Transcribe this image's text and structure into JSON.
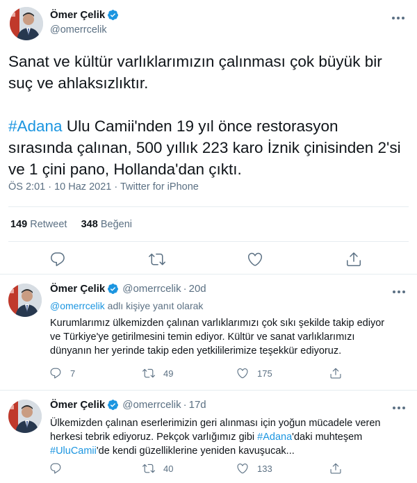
{
  "colors": {
    "accent": "#1b95e0",
    "secondary_text": "#5b7083",
    "primary_text": "#0f1419",
    "divider": "#e6ecf0"
  },
  "main_tweet": {
    "author_name": "Ömer Çelik",
    "handle": "@omerrcelik",
    "text_line1": "Sanat ve kültür varlıklarımızın çalınması çok büyük bir",
    "text_line2": "suç ve ahlaksızlıktır.",
    "hashtag": "#Adana",
    "text_line3_rest": " Ulu Camii'nden 19 yıl önce restorasyon",
    "text_line4": "sırasında çalınan, 500 yıllık 223 karo İznik çinisinden 2'si",
    "text_line5": "ve 1 çini pano, Hollanda'dan çıktı.",
    "time": "ÖS 2:01",
    "separator": "·",
    "date": "10 Haz 2021",
    "source": "Twitter for iPhone",
    "retweet_count": "149",
    "retweet_label": "Retweet",
    "like_count": "348",
    "like_label": "Beğeni",
    "icons": [
      "reply-icon",
      "retweet-icon",
      "like-icon",
      "share-icon"
    ]
  },
  "replies": [
    {
      "author_name": "Ömer Çelik",
      "handle": "@omerrcelik",
      "separator": "·",
      "date": "20d",
      "replying_mention": "@omerrcelik",
      "replying_rest": " adlı kişiye yanıt olarak",
      "line1": "Kurumlarımız ülkemizden çalınan varlıklarımızı çok sıkı şekilde takip ediyor",
      "line2": "ve Türkiye'ye getirilmesini temin ediyor. Kültür ve sanat varlıklarımızı",
      "line3": "dünyanın her yerinde takip eden yetkililerimize teşekkür ediyoruz.",
      "reply_count": "7",
      "retweet_count": "49",
      "like_count": "175"
    },
    {
      "author_name": "Ömer Çelik",
      "handle": "@omerrcelik",
      "separator": "·",
      "date": "17d",
      "line1": "Ülkemizden çalınan eserlerimizin geri alınması için yoğun mücadele veren",
      "line2_pre": "herkesi tebrik ediyoruz. Pekçok varlığımız gibi ",
      "line2_hashtag": "#Adana",
      "line2_post": "'daki muhteşem",
      "line3_hashtag": "#UluCamii",
      "line3_post": "'de kendi güzelliklerine yeniden kavuşucak...",
      "reply_count": "",
      "retweet_count": "40",
      "like_count": "133"
    }
  ]
}
